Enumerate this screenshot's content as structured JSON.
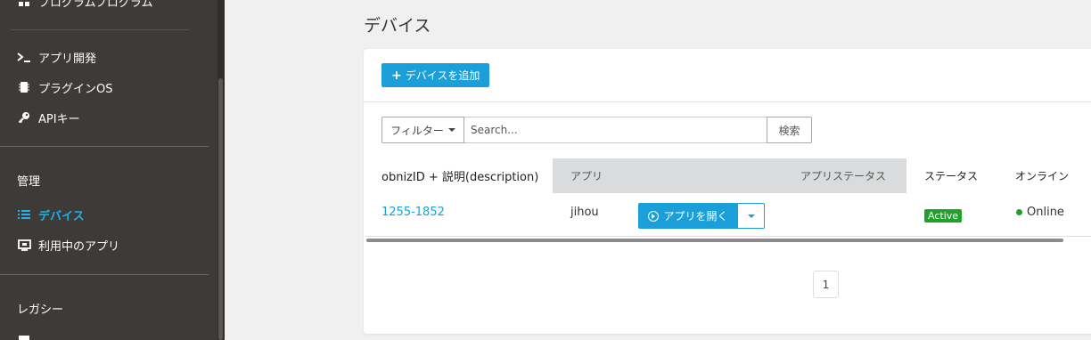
{
  "sidebar": {
    "partial_top_label": "プログラムプログラム",
    "items": [
      {
        "label": "アプリ開発",
        "icon": "terminal-icon"
      },
      {
        "label": "プラグインOS",
        "icon": "chip-icon"
      },
      {
        "label": "APIキー",
        "icon": "key-icon"
      }
    ],
    "section_manage": "管理",
    "manage_items": [
      {
        "label": "デバイス",
        "icon": "list-icon",
        "active": true
      },
      {
        "label": "利用中のアプリ",
        "icon": "monitor-icon"
      }
    ],
    "section_legacy": "レガシー",
    "accent_color": "#1fb1e8"
  },
  "main": {
    "title": "デバイス",
    "add_button": "デバイスを追加",
    "filter_label": "フィルター",
    "search_placeholder": "Search...",
    "search_button": "検索",
    "columns": [
      "obnizID + 説明(description)",
      "アプリ",
      "アプリステータス",
      "ステータス",
      "オンライン"
    ],
    "rows": [
      {
        "obniz_id": "1255-1852",
        "app": "jihou",
        "open_button": "アプリを開く",
        "status": "Active",
        "online": "Online"
      }
    ],
    "pagination": [
      "1"
    ]
  }
}
